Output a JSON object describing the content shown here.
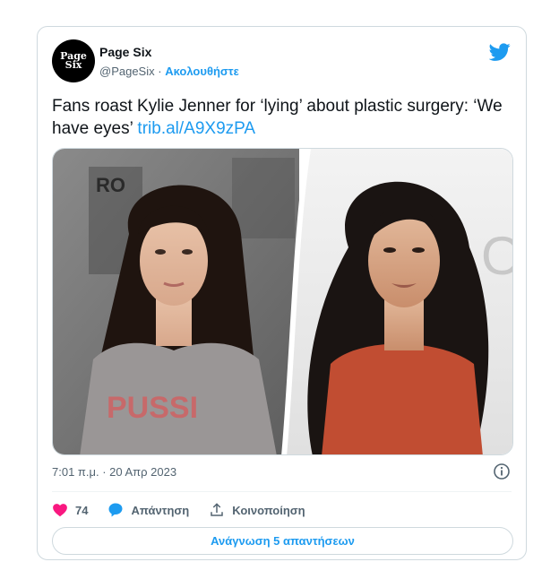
{
  "author": {
    "avatar_line1": "Page",
    "avatar_line2": "Six",
    "name": "Page Six",
    "handle": "@PageSix",
    "separator": "·",
    "follow_label": "Ακολουθήστε"
  },
  "tweet": {
    "text": "Fans roast Kylie Jenner for ‘lying’ about plastic surgery: ‘We have eyes’",
    "link": "trib.al/A9X9zPA",
    "timestamp": "7:01 π.μ. · 20 Απρ 2023"
  },
  "media": {
    "left_sign_text": "RO",
    "left_shirt_text": "PUSSI",
    "right_sign_text": "O"
  },
  "actions": {
    "like_count": "74",
    "reply_label": "Απάντηση",
    "share_label": "Κοινοποίηση"
  },
  "read_replies_label": "Ανάγνωση 5 απαντήσεων",
  "colors": {
    "brand_blue": "#1d9bf0",
    "like_red": "#f91880",
    "muted": "#536471",
    "border": "#cfd9de"
  }
}
